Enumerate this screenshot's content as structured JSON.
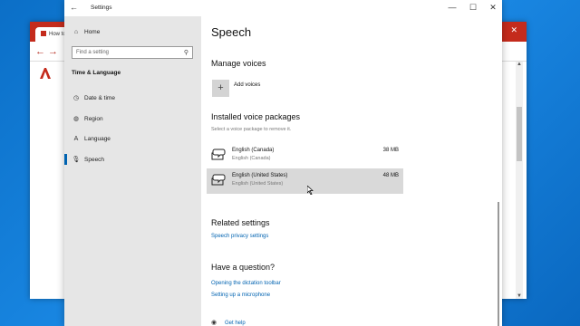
{
  "browser": {
    "tab_label": "How to",
    "close_glyph": "✕"
  },
  "settings": {
    "window_title": "Settings",
    "controls": {
      "minimize": "—",
      "maximize": "☐",
      "close": "✕"
    },
    "nav": {
      "home": "Home",
      "search_placeholder": "Find a setting",
      "section": "Time & Language",
      "items": [
        {
          "label": "Date & time",
          "icon": "calendar-clock-icon"
        },
        {
          "label": "Region",
          "icon": "globe-icon"
        },
        {
          "label": "Language",
          "icon": "language-icon"
        },
        {
          "label": "Speech",
          "icon": "microphone-icon"
        }
      ],
      "active_item": "Speech"
    },
    "content": {
      "title": "Speech",
      "manage_voices": "Manage voices",
      "add_voices": "Add voices",
      "installed_header": "Installed voice packages",
      "installed_sub": "Select a voice package to remove it.",
      "voices": [
        {
          "name": "English (Canada)",
          "sub": "English (Canada)",
          "size": "38 MB",
          "selected": false
        },
        {
          "name": "English (United States)",
          "sub": "English (United States)",
          "size": "48 MB",
          "selected": true
        }
      ],
      "related_header": "Related settings",
      "related_link": "Speech privacy settings",
      "question_header": "Have a question?",
      "question_links": [
        "Opening the dictation toolbar",
        "Setting up a microphone"
      ],
      "help_link": "Get help"
    }
  },
  "colors": {
    "accent": "#0063b1",
    "nav_bg": "#e6e6e6",
    "browser_red": "#c42b1c",
    "desktop_blue": "#0b6fc7"
  }
}
